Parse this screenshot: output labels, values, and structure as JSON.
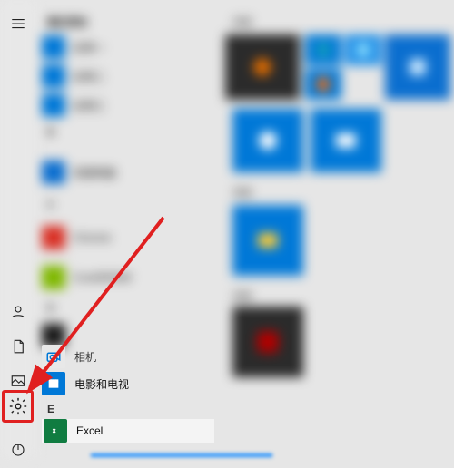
{
  "rail": {
    "expand": "展开",
    "user": "用户",
    "documents": "文档",
    "pictures": "图片",
    "settings": "设置",
    "power": "电源"
  },
  "apps": {
    "header_recent": "最近添加",
    "items_recent": [
      {
        "label": "应用一",
        "color": "#0078d7"
      },
      {
        "label": "应用二",
        "color": "#0078d7"
      },
      {
        "label": "应用三",
        "color": "#0078d7"
      }
    ],
    "header_b": "B",
    "items_b": [
      {
        "label": "百度网盘",
        "color": "#0a6ecf"
      }
    ],
    "header_c": "C",
    "items_c": [
      {
        "label": "Chrome",
        "color": "#d93025"
      },
      {
        "label": "CorelDRAW",
        "color": "#7fb800"
      }
    ],
    "header_d": "D",
    "movies_label": "电影和电视",
    "header_e": "E",
    "excel_label": "Excel"
  },
  "tiles": {
    "section1": "浏览",
    "section2": "浏览",
    "section3": "浏览"
  },
  "colors": {
    "accent": "#0078d7",
    "highlight": "#e02020",
    "excel": "#107c41"
  }
}
